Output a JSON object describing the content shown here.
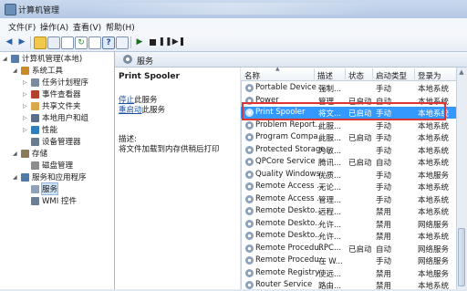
{
  "window": {
    "title": "计算机管理"
  },
  "menu": [
    "文件(F)",
    "操作(A)",
    "查看(V)",
    "帮助(H)"
  ],
  "tree": [
    {
      "label": "计算机管理(本地)",
      "level": 0,
      "toggle": "◢"
    },
    {
      "label": "系统工具",
      "level": 1,
      "toggle": "◢"
    },
    {
      "label": "任务计划程序",
      "level": 2,
      "toggle": "▷"
    },
    {
      "label": "事件查看器",
      "level": 2,
      "toggle": "▷"
    },
    {
      "label": "共享文件夹",
      "level": 2,
      "toggle": "▷"
    },
    {
      "label": "本地用户和组",
      "level": 2,
      "toggle": "▷"
    },
    {
      "label": "性能",
      "level": 2,
      "toggle": "▷"
    },
    {
      "label": "设备管理器",
      "level": 2,
      "toggle": ""
    },
    {
      "label": "存储",
      "level": 1,
      "toggle": "◢"
    },
    {
      "label": "磁盘管理",
      "level": 2,
      "toggle": ""
    },
    {
      "label": "服务和应用程序",
      "level": 1,
      "toggle": "◢"
    },
    {
      "label": "服务",
      "level": 2,
      "toggle": ""
    },
    {
      "label": "WMI 控件",
      "level": 2,
      "toggle": ""
    }
  ],
  "center": {
    "title": "服务",
    "service_name": "Print Spooler",
    "stop_link": "停止",
    "stop_suffix": "此服务",
    "restart_link": "重启动",
    "restart_suffix": "此服务",
    "desc_label": "描述:",
    "desc_text": "将文件加载到内存供稍后打印"
  },
  "columns": [
    "名称",
    "描述",
    "状态",
    "启动类型",
    "登录为"
  ],
  "services": [
    {
      "name": "Portable Device ...",
      "desc": "强制...",
      "status": "",
      "startup": "手动",
      "logon": "本地系统"
    },
    {
      "name": "Power",
      "desc": "管理...",
      "status": "已启动",
      "startup": "自动",
      "logon": "本地系统"
    },
    {
      "name": "Print Spooler",
      "desc": "将文...",
      "status": "已启动",
      "startup": "手动",
      "logon": "本地系统"
    },
    {
      "name": "Problem Report...",
      "desc": "此服...",
      "status": "",
      "startup": "手动",
      "logon": "本地系统"
    },
    {
      "name": "Program Compa...",
      "desc": "此服...",
      "status": "已启动",
      "startup": "手动",
      "logon": "本地系统"
    },
    {
      "name": "Protected Storage",
      "desc": "为敏...",
      "status": "",
      "startup": "手动",
      "logon": "本地系统"
    },
    {
      "name": "QPCore Service",
      "desc": "腾讯...",
      "status": "已启动",
      "startup": "自动",
      "logon": "本地系统"
    },
    {
      "name": "Quality Windows...",
      "desc": "优质...",
      "status": "",
      "startup": "手动",
      "logon": "本地服务"
    },
    {
      "name": "Remote Access ...",
      "desc": "无论...",
      "status": "",
      "startup": "手动",
      "logon": "本地系统"
    },
    {
      "name": "Remote Access ...",
      "desc": "管理...",
      "status": "",
      "startup": "手动",
      "logon": "本地系统"
    },
    {
      "name": "Remote Deskto...",
      "desc": "远程...",
      "status": "",
      "startup": "禁用",
      "logon": "本地系统"
    },
    {
      "name": "Remote Deskto...",
      "desc": "允许...",
      "status": "",
      "startup": "禁用",
      "logon": "网络服务"
    },
    {
      "name": "Remote Deskto...",
      "desc": "允许...",
      "status": "",
      "startup": "禁用",
      "logon": "本地系统"
    },
    {
      "name": "Remote Procedu...",
      "desc": "RPC...",
      "status": "已启动",
      "startup": "自动",
      "logon": "网络服务"
    },
    {
      "name": "Remote Procedu...",
      "desc": "在 W...",
      "status": "",
      "startup": "手动",
      "logon": "网络服务"
    },
    {
      "name": "Remote Registry",
      "desc": "使远...",
      "status": "",
      "startup": "禁用",
      "logon": "本地服务"
    },
    {
      "name": "Router Service",
      "desc": "路由...",
      "status": "",
      "startup": "禁用",
      "logon": "本地系统"
    }
  ],
  "selected_service": "Print Spooler",
  "colors": {
    "selection": "#3399ff",
    "highlight_box": "#e03434",
    "link": "#1c4fa8"
  }
}
